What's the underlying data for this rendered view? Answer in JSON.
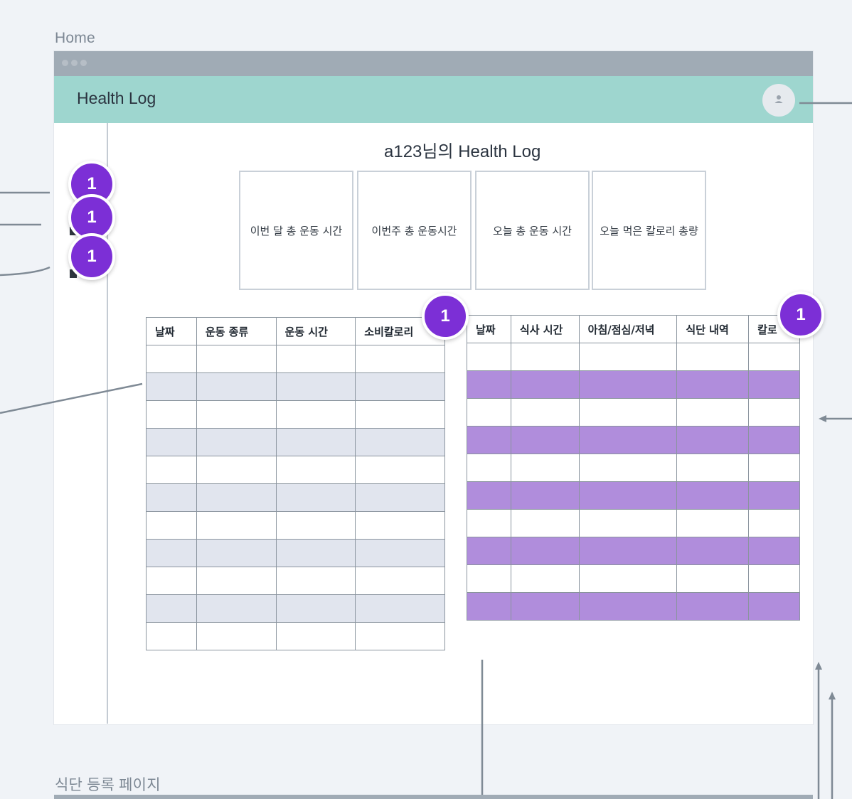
{
  "frames": {
    "home_label": "Home",
    "diet_page_label": "식단 등록 페이지"
  },
  "app": {
    "title": "Health Log",
    "profile_icon": "user-icon"
  },
  "page": {
    "title": "a123님의 Health Log"
  },
  "summary_cards": [
    {
      "label": "이번 달 총 운동 시간"
    },
    {
      "label": "이번주 총 운동시간"
    },
    {
      "label": "오늘 총 운동 시간"
    },
    {
      "label": "오늘 먹은 칼로리 총량"
    }
  ],
  "exercise_table": {
    "headers": [
      "날짜",
      "운동 종류",
      "운동 시간",
      "소비칼로리"
    ],
    "row_count": 11,
    "alt_row_color": "#e1e5ee"
  },
  "meal_table": {
    "headers": [
      "날짜",
      "식사 시간",
      "아침/점심/저녁",
      "식단 내역",
      "칼로"
    ],
    "row_count": 10,
    "alt_row_color": "#b08ddc"
  },
  "badges": {
    "nav_1": "1",
    "nav_2": "1",
    "nav_3": "1",
    "exercise": "1",
    "meal": "1"
  },
  "colors": {
    "appbar": "#9ed6cf",
    "titlebar": "#a0abb5",
    "badge": "#7c2fd6",
    "background": "#f0f3f7"
  }
}
